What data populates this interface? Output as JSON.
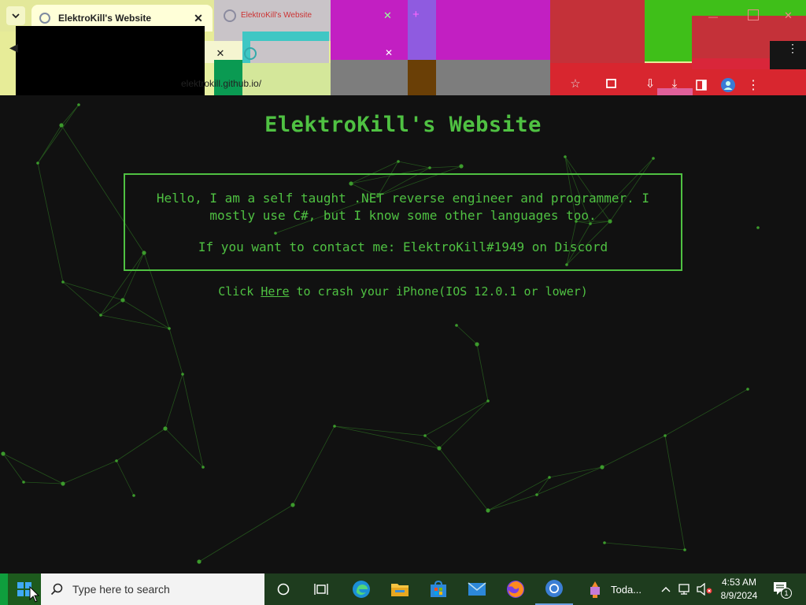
{
  "browser": {
    "tabs": [
      {
        "title": "ElektroKill's Website",
        "active": true
      },
      {
        "title": "ElektroKill's Website",
        "active": false
      }
    ],
    "address": "elektrokill.github.io/"
  },
  "page": {
    "title": "ElektroKill's Website",
    "about_line": "Hello, I am a self taught .NET reverse engineer and programmer. I mostly use C#, but I know some other languages too.",
    "contact_line": "If you want to contact me: ElektroKill#1949 on Discord",
    "click_prefix": "Click ",
    "click_link": "Here",
    "click_suffix": " to crash your iPhone(IOS 12.0.1 or lower)"
  },
  "taskbar": {
    "search_placeholder": "Type here to search",
    "app_label": "Toda...",
    "time": "4:53 AM",
    "date": "8/9/2024",
    "notification_count": "1"
  },
  "colors": {
    "accent": "#4fc142",
    "page_bg": "#111111",
    "network": "#2f7a22"
  },
  "icons": [
    "chevron-down-icon",
    "globe-icon",
    "close-icon",
    "plus-icon",
    "star-icon",
    "extension-icon",
    "download-icon",
    "sidebar-icon",
    "profile-icon",
    "menu-icon",
    "windows-icon",
    "search-icon",
    "cortana-icon",
    "task-view-icon",
    "edge-icon",
    "file-explorer-icon",
    "store-icon",
    "mail-icon",
    "firefox-icon",
    "chrome-icon",
    "app-icon",
    "chevron-up-icon",
    "network-icon",
    "volume-icon",
    "notification-icon"
  ]
}
